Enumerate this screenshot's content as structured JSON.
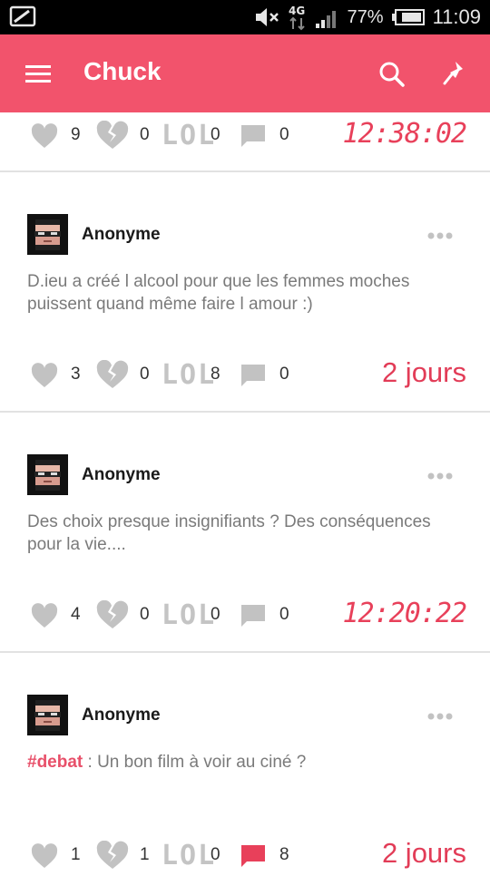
{
  "status_bar": {
    "battery": "77%",
    "time": "11:09",
    "network": "4G"
  },
  "app_bar": {
    "title": "Chuck",
    "icons": [
      "menu-icon",
      "search-icon",
      "pin-icon"
    ],
    "color": "#f2536c"
  },
  "posts": [
    {
      "likes": "9",
      "dislikes": "0",
      "lol_label": "LOL",
      "lols": "0",
      "comments": "0",
      "timestamp": "12:38:02",
      "comment_active": false
    },
    {
      "author": "Anonyme",
      "text": "D.ieu a créé l alcool pour que les femmes moches puissent quand même faire l amour :)",
      "likes": "3",
      "dislikes": "0",
      "lol_label": "LOL",
      "lols": "8",
      "comments": "0",
      "timestamp": "2 jours",
      "comment_active": false
    },
    {
      "author": "Anonyme",
      "text": "Des choix presque insignifiants ? Des conséquences pour la vie....",
      "likes": "4",
      "dislikes": "0",
      "lol_label": "LOL",
      "lols": "0",
      "comments": "0",
      "timestamp": "12:20:22",
      "comment_active": false
    },
    {
      "author": "Anonyme",
      "hashtag": "#debat",
      "text": " : Un bon film à voir au ciné ?",
      "likes": "1",
      "dislikes": "1",
      "lol_label": "LOL",
      "lols": "0",
      "comments": "8",
      "timestamp": "2 jours",
      "comment_active": true
    }
  ],
  "colors": {
    "accent": "#f2536c",
    "timestamp": "#e8405a",
    "icon_gray": "#bdbdbd"
  }
}
